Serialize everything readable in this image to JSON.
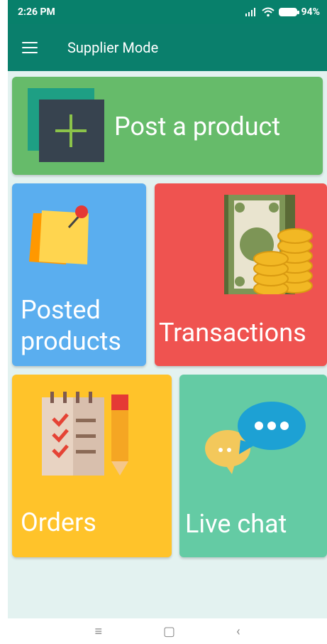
{
  "status_bar": {
    "time": "2:26 PM",
    "battery": "94%"
  },
  "app_bar": {
    "title": "Supplier Mode"
  },
  "tiles": {
    "post_product": "Post a product",
    "posted_products_line1": "Posted",
    "posted_products_line2": "products",
    "transactions": "Transactions",
    "orders": "Orders",
    "live_chat": "Live chat"
  },
  "nav_bar": {
    "menu": "≡",
    "home": "▢",
    "back": "‹"
  },
  "colors": {
    "app_bar": "#0a7f6c",
    "post_product": "#66bb6a",
    "posted_products": "#5aaeef",
    "transactions": "#ef5350",
    "orders": "#ffc32a",
    "live_chat": "#64cba4",
    "background": "#e3f2f0"
  }
}
